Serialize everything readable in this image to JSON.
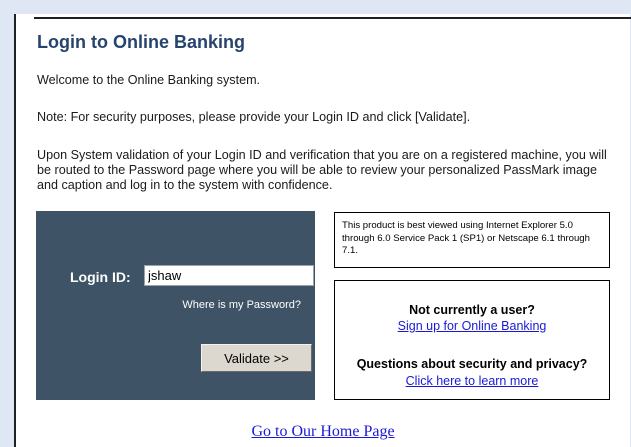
{
  "title": "Login to Online Banking",
  "paragraphs": {
    "welcome": "Welcome to the Online Banking system.",
    "note": "Note: For security purposes, please provide your Login ID and click [Validate].",
    "validation": "Upon System validation of your Login ID and verification that you are on a registered machine, you will be routed to the Password page where you will be able to review your personalized PassMark image and caption and log in to the system with confidence."
  },
  "login_form": {
    "label": "Login ID:",
    "value": "jshaw",
    "forgot_link": "Where is my Password?",
    "validate_label": "Validate >>"
  },
  "browser_note": "This product is best viewed using Internet Explorer 5.0 through 6.0 Service Pack 1 (SP1) or Netscape 6.1 through 7.1.",
  "user_box": {
    "not_user_heading": "Not currently a user?",
    "signup_link": "Sign up for Online Banking",
    "security_heading": "Questions about security and privacy?",
    "security_link": "Click here to learn more"
  },
  "home_link": "Go to Our Home Page",
  "colors": {
    "page_background": "#dfe6f4",
    "title": "#26446d",
    "login_panel": "#3e5466",
    "link": "#1a1ad6"
  }
}
